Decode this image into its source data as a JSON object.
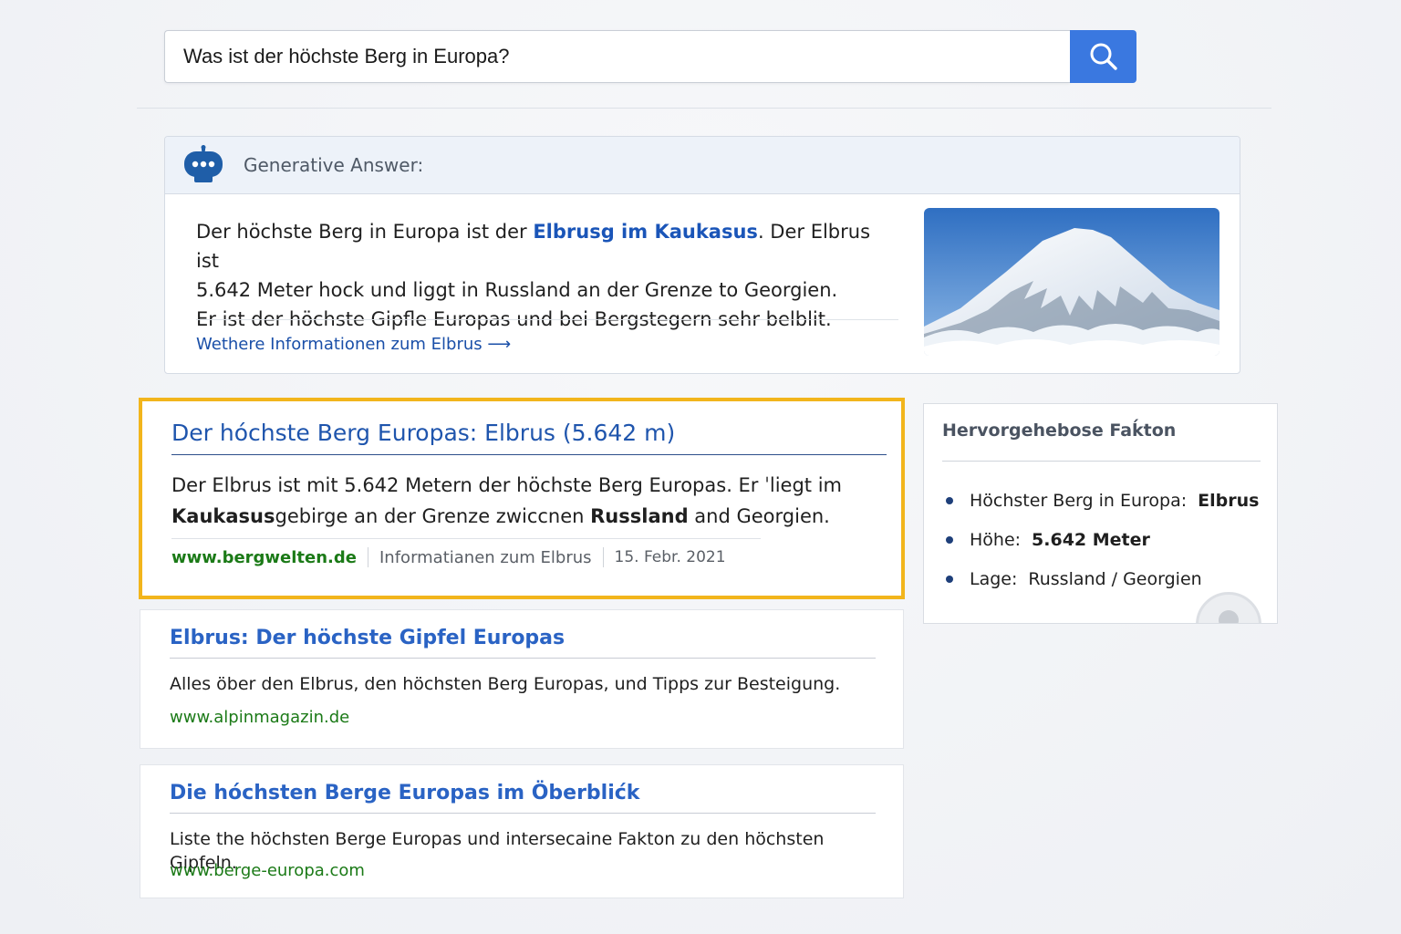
{
  "search": {
    "query": "Was ist der höchste Berg in Europa?",
    "button_icon": "search-icon",
    "button_color": "#3a78e0"
  },
  "generative_answer": {
    "header": "Generative Answer:",
    "icon": "robot-icon",
    "line1_before": "Der höchste Berg in Europa ist der ",
    "line1_highlight": "Elbrusg im Kaukasus",
    "line1_after": ". Der Elbrus ist",
    "line2": "5.642 Meter hock und liggt in Russland an der Grenze to Georgien.",
    "line3": "Er ist der höchste Gipfle Europas und bei Bergstegern sehr belblit.",
    "more_link": "Wethere Informationen zum Elbrus ⟶",
    "image": "snow-capped-mountain-image"
  },
  "results": [
    {
      "title": "Der hóchste Berg Europas: Elbrus (5.642 m)",
      "snippet_line1": "Der Elbrus ist mit 5.642 Metern der höchste Berg Europas. Er ˈliegt im",
      "snippet_bold1": "Kaukasus",
      "snippet_mid": "gebirge an der Grenze zwiccnen ",
      "snippet_bold2": "Russland",
      "snippet_end": " and Georgien.",
      "url": "www.bergwelten.de",
      "info": "Informatianen zum Elbrus",
      "date": "15. Febr. 2021",
      "highlight_color": "#f2b51c"
    },
    {
      "title": "Elbrus: Der höchste Gipfel Europas",
      "snippet": "Alles öber den Elbrus, den höchsten Berg Europas, und Tipps zur Besteigung.",
      "url": "www.alpinmagazin.de"
    },
    {
      "title": "Die hóchsten Berge Europas im Öberblićk",
      "snippet": "Liste the höchsten Berge Europas und intersecaine Fakton zu den höchsten Gipfeln.",
      "url": "www.berge-europa.com"
    }
  ],
  "facts": {
    "title": "Hervorgehebose Faḱton",
    "items": [
      {
        "label": "Höchster Berg in Europa:",
        "value": "Elbrus"
      },
      {
        "label": "Höhe:",
        "value": "5.642 Meter"
      },
      {
        "label": "Lage:",
        "value": "Russland / Georgien"
      }
    ]
  }
}
